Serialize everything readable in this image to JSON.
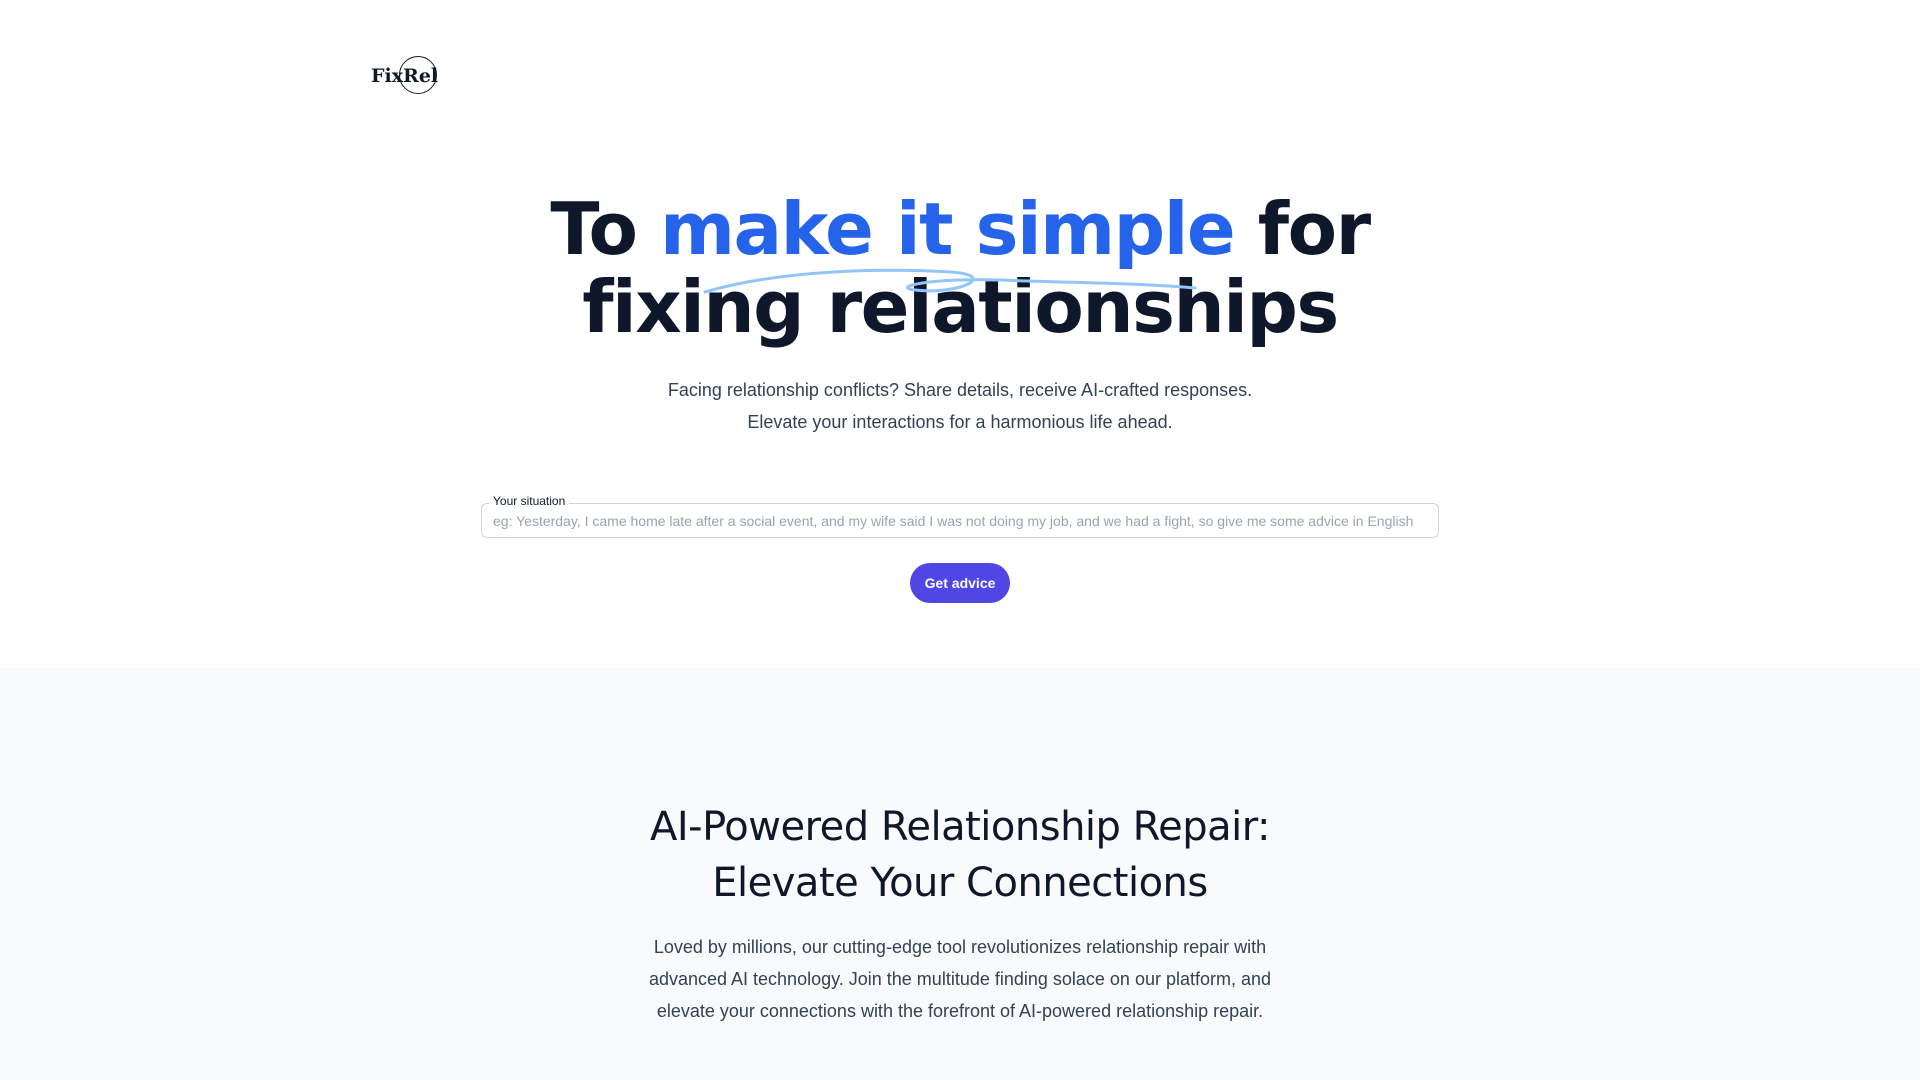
{
  "header": {
    "logo_text": "FixRel"
  },
  "hero": {
    "title_prefix": "To ",
    "title_accent": "make it simple",
    "title_suffix": " for",
    "title_line2": "fixing relationships",
    "subtitle_line1": "Facing relationship conflicts? Share details, receive AI-crafted responses.",
    "subtitle_line2": "Elevate your interactions for a harmonious life ahead."
  },
  "form": {
    "field_label": "Your situation",
    "placeholder": "eg: Yesterday, I came home late after a social event, and my wife said I was not doing my job, and we had a fight, so give me some advice in English",
    "value": "",
    "button_label": "Get advice"
  },
  "features": {
    "title_line1": "AI-Powered Relationship Repair:",
    "title_line2": "Elevate Your Connections",
    "body": "Loved by millions, our cutting-edge tool revolutionizes relationship repair with advanced AI technology. Join the multitude finding solace on our platform, and elevate your connections with the forefront of AI-powered relationship repair."
  },
  "colors": {
    "accent": "#2563eb",
    "button": "#4f46e5",
    "heading": "#0f172a",
    "section_bg": "#f8fafc"
  },
  "icons": {
    "logo": "circle-logo-mark",
    "squiggle": "hand-drawn-underline"
  }
}
